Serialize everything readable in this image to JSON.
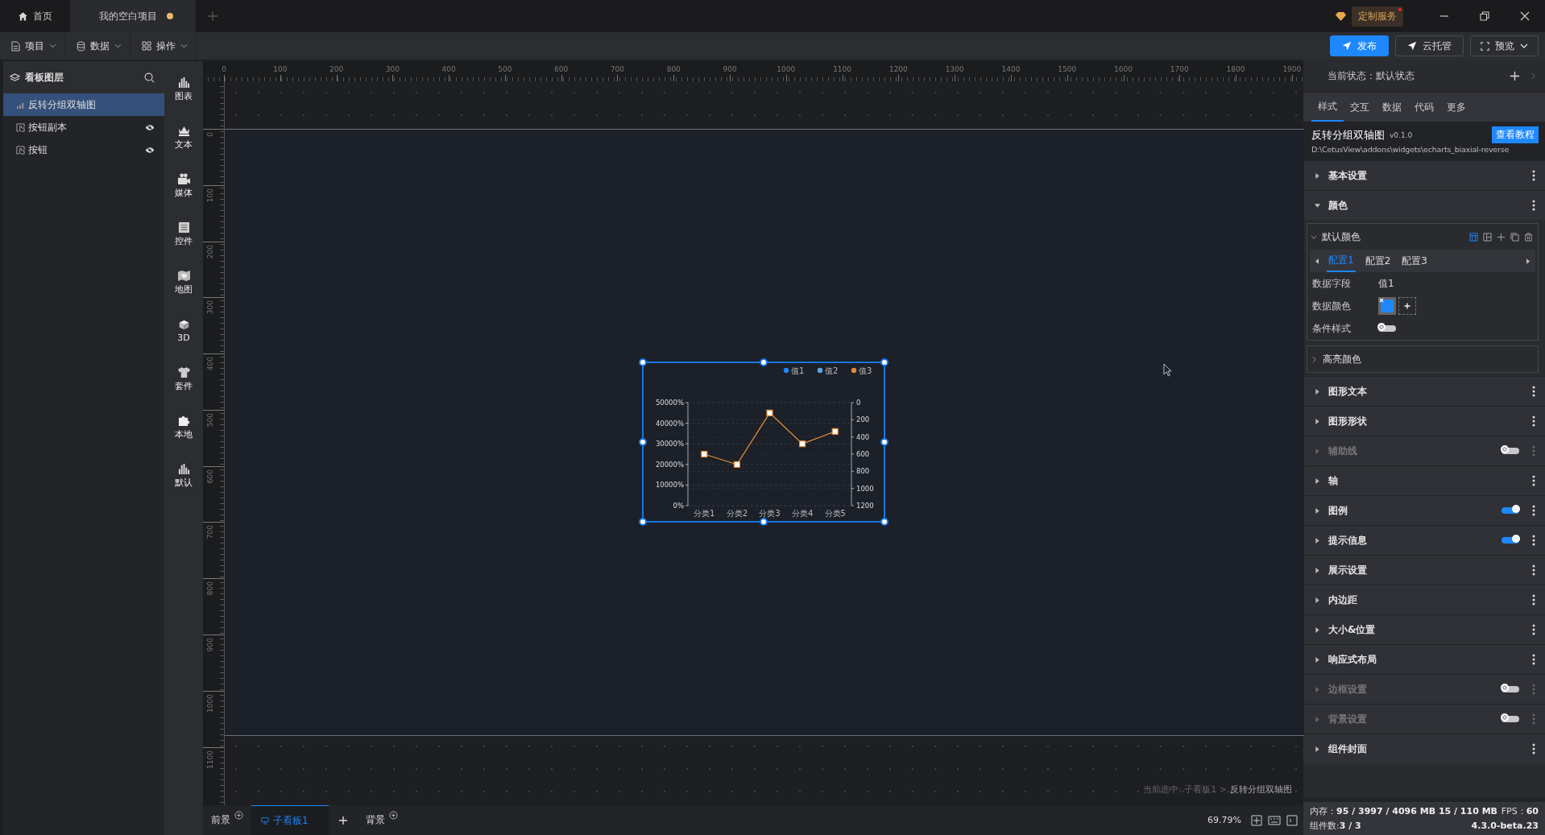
{
  "top_tabs": [
    {
      "label": "首页",
      "kind": "home",
      "selected": false,
      "unsaved": false
    },
    {
      "label": "我的空白项目",
      "kind": "project",
      "selected": true,
      "unsaved": true
    }
  ],
  "service_badge": "定制服务",
  "menus": [
    {
      "label": "项目"
    },
    {
      "label": "数据"
    },
    {
      "label": "操作"
    }
  ],
  "actions": [
    {
      "label": "发布",
      "kind": "primary"
    },
    {
      "label": "云托管",
      "kind": "outline"
    },
    {
      "label": "预览",
      "kind": "dropdown"
    }
  ],
  "layers": {
    "title": "看板图层",
    "items": [
      {
        "label": "反转分组双轴图",
        "kind": "chart",
        "selected": true,
        "hidden": false
      },
      {
        "label": "按钮副本",
        "kind": "button",
        "selected": false,
        "hidden": true
      },
      {
        "label": "按钮",
        "kind": "button",
        "selected": false,
        "hidden": true
      }
    ]
  },
  "categories": [
    {
      "label": "图表"
    },
    {
      "label": "文本"
    },
    {
      "label": "媒体"
    },
    {
      "label": "控件"
    },
    {
      "label": "地图"
    },
    {
      "label": "3D"
    },
    {
      "label": "套件"
    },
    {
      "label": "本地"
    },
    {
      "label": "默认"
    }
  ],
  "ruler": {
    "x_labels": [
      "0",
      "100",
      "200",
      "300",
      "400",
      "500",
      "600",
      "700",
      "800",
      "900",
      "1000",
      "1100",
      "1200",
      "1300",
      "1400",
      "1500",
      "1600",
      "1700",
      "1800",
      "1900"
    ],
    "y_labels": [
      "0",
      "100",
      "200",
      "300",
      "400",
      "500",
      "600",
      "700",
      "800",
      "900",
      "1000",
      "1100"
    ]
  },
  "widget": {
    "selected": true,
    "right_axis_labels": [
      "0",
      "200",
      "400",
      "600",
      "800",
      "1000",
      "1200"
    ],
    "chart_data": {
      "type": "line",
      "categories": [
        "分类1",
        "分类2",
        "分类3",
        "分类4",
        "分类5"
      ],
      "series": [
        {
          "name": "值1",
          "color": "#1e88ff",
          "values": [
            null,
            null,
            null,
            null,
            null
          ]
        },
        {
          "name": "值2",
          "color": "#5aa9e6",
          "values": [
            null,
            null,
            null,
            null,
            null
          ]
        },
        {
          "name": "值3",
          "color": "#e08a3c",
          "marker": "square",
          "values": [
            25000,
            20000,
            45000,
            30000,
            36000
          ]
        }
      ],
      "grid": true,
      "ylim": [
        0,
        50000
      ],
      "yticks": [
        {
          "value": 0,
          "label": "0%"
        },
        {
          "value": 10000,
          "label": "10000%"
        },
        {
          "value": 20000,
          "label": "20000%"
        },
        {
          "value": 30000,
          "label": "30000%"
        },
        {
          "value": 40000,
          "label": "40000%"
        },
        {
          "value": 50000,
          "label": "50000%"
        }
      ]
    }
  },
  "selection_path": {
    "trail": "当前选中: 子看板1 >",
    "current": "反转分组双轴图"
  },
  "board_tabs": [
    {
      "label": "前景",
      "kind": "layer",
      "selected": false
    },
    {
      "label": "子看板1",
      "kind": "board",
      "selected": true
    },
    {
      "label": "背景",
      "kind": "layer",
      "selected": false
    }
  ],
  "zoom": "69.79%",
  "state_label": "当前状态：默认状态",
  "panel_tabs": [
    {
      "label": "样式",
      "selected": true
    },
    {
      "label": "交互",
      "selected": false
    },
    {
      "label": "数据",
      "selected": false
    },
    {
      "label": "代码",
      "selected": false
    },
    {
      "label": "更多",
      "selected": false
    }
  ],
  "widget_info": {
    "name": "反转分组双轴图",
    "version": "v0.1.0",
    "tutorial": "查看教程",
    "path": "D:\\CetusView\\addons\\widgets\\echarts_biaxial-reverse"
  },
  "color_panel": {
    "title": "默认颜色",
    "expanded": true,
    "configs": [
      {
        "label": "配置1",
        "selected": true
      },
      {
        "label": "配置2",
        "selected": false
      },
      {
        "label": "配置3",
        "selected": false
      }
    ],
    "fields": [
      {
        "label": "数据字段",
        "kind": "text",
        "value": "值1"
      },
      {
        "label": "数据颜色",
        "kind": "color",
        "color": "#1e88ff"
      },
      {
        "label": "条件样式",
        "kind": "toggle",
        "on": false
      }
    ],
    "highlight_title": "高亮颜色",
    "highlight_expanded": false
  },
  "sections": [
    {
      "label": "基本设置",
      "kind": "plain",
      "expanded": false,
      "disabled": false
    },
    {
      "label": "颜色",
      "kind": "color",
      "expanded": true,
      "disabled": false
    },
    {
      "label": "图形文本",
      "kind": "plain",
      "expanded": false,
      "disabled": false
    },
    {
      "label": "图形形状",
      "kind": "plain",
      "expanded": false,
      "disabled": false
    },
    {
      "label": "辅助线",
      "kind": "toggle",
      "on": false,
      "expanded": false,
      "disabled": true
    },
    {
      "label": "轴",
      "kind": "plain",
      "expanded": false,
      "disabled": false
    },
    {
      "label": "图例",
      "kind": "toggle",
      "on": true,
      "expanded": false,
      "disabled": false
    },
    {
      "label": "提示信息",
      "kind": "toggle",
      "on": true,
      "expanded": false,
      "disabled": false
    },
    {
      "label": "展示设置",
      "kind": "plain",
      "expanded": false,
      "disabled": false
    },
    {
      "label": "内边距",
      "kind": "plain",
      "expanded": false,
      "disabled": false
    },
    {
      "label": "大小&位置",
      "kind": "plain",
      "expanded": false,
      "disabled": false
    },
    {
      "label": "响应式布局",
      "kind": "plain",
      "expanded": false,
      "disabled": false
    },
    {
      "label": "边框设置",
      "kind": "toggle",
      "on": false,
      "expanded": false,
      "disabled": true
    },
    {
      "label": "背景设置",
      "kind": "toggle",
      "on": false,
      "expanded": false,
      "disabled": true
    },
    {
      "label": "组件封面",
      "kind": "plain",
      "expanded": false,
      "disabled": false
    }
  ],
  "status": {
    "memory_label": "内存：",
    "memory_value": "95 / 3997 / 4096 MB  15 / 110 MB",
    "fps_label": "FPS：",
    "fps_value": "60",
    "count_label": "组件数:",
    "count_value": "3 / 3",
    "version": "4.3.0-beta.23"
  }
}
